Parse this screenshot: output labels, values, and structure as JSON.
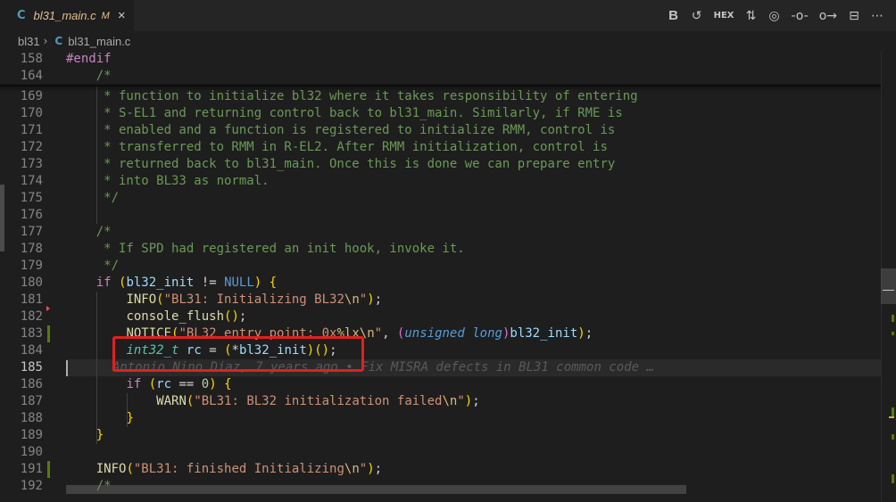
{
  "tab": {
    "lang_badge": "C",
    "filename": "bl31_main.c",
    "modified": "M",
    "close": "×"
  },
  "actions": [
    {
      "name": "toggle-blame-b-icon",
      "glyph": "B"
    },
    {
      "name": "history-icon",
      "glyph": "↺"
    },
    {
      "name": "hex-icon",
      "glyph": "HEX"
    },
    {
      "name": "compare-changes-icon",
      "glyph": "⇅"
    },
    {
      "name": "open-changes-icon",
      "glyph": "◎"
    },
    {
      "name": "previous-change-icon",
      "glyph": "-o-"
    },
    {
      "name": "next-change-icon",
      "glyph": "o→"
    },
    {
      "name": "split-editor-icon",
      "glyph": "⊟"
    },
    {
      "name": "more-actions-icon",
      "glyph": "⋯"
    }
  ],
  "breadcrumb": {
    "folder": "bl31",
    "separator": "›",
    "lang_badge": "C",
    "file": "bl31_main.c"
  },
  "sticky_lines": [
    {
      "num": "158",
      "code": "#endif"
    },
    {
      "num": "164",
      "code": "    /*"
    }
  ],
  "lines": [
    {
      "num": "169",
      "code": "     * function to initialize bl32 where it takes responsibility of entering"
    },
    {
      "num": "170",
      "code": "     * S-EL1 and returning control back to bl31_main. Similarly, if RME is"
    },
    {
      "num": "171",
      "code": "     * enabled and a function is registered to initialize RMM, control is"
    },
    {
      "num": "172",
      "code": "     * transferred to RMM in R-EL2. After RMM initialization, control is"
    },
    {
      "num": "173",
      "code": "     * returned back to bl31_main. Once this is done we can prepare entry"
    },
    {
      "num": "174",
      "code": "     * into BL33 as normal."
    },
    {
      "num": "175",
      "code": "     */"
    },
    {
      "num": "176",
      "code": ""
    },
    {
      "num": "177",
      "code": "    /*"
    },
    {
      "num": "178",
      "code": "     * If SPD had registered an init hook, invoke it."
    },
    {
      "num": "179",
      "code": "     */"
    },
    {
      "num": "180",
      "code": "    if (bl32_init != NULL) {"
    },
    {
      "num": "181",
      "code": "        INFO(\"BL31: Initializing BL32\\n\");"
    },
    {
      "num": "182",
      "code": "        console_flush();"
    },
    {
      "num": "183",
      "code": "        NOTICE(\"BL32 entry point: 0x%lx\\n\", (unsigned long)bl32_init);"
    },
    {
      "num": "184",
      "code": "        int32_t rc = (*bl32_init)();"
    },
    {
      "num": "185",
      "code": "",
      "blame": "Antonio Nino Diaz, 7 years ago • Fix MISRA defects in BL31 common code …"
    },
    {
      "num": "186",
      "code": "        if (rc == 0) {"
    },
    {
      "num": "187",
      "code": "            WARN(\"BL31: BL32 initialization failed\\n\");"
    },
    {
      "num": "188",
      "code": "        }"
    },
    {
      "num": "189",
      "code": "    }"
    },
    {
      "num": "190",
      "code": ""
    },
    {
      "num": "191",
      "code": "    INFO(\"BL31: finished Initializing\\n\");"
    },
    {
      "num": "192",
      "code": "    /*"
    }
  ],
  "colors": {
    "highlight_box": "#e02020",
    "comment": "#6a9955",
    "keyword": "#c586c0",
    "function": "#dcdcaa",
    "string": "#ce9178"
  }
}
